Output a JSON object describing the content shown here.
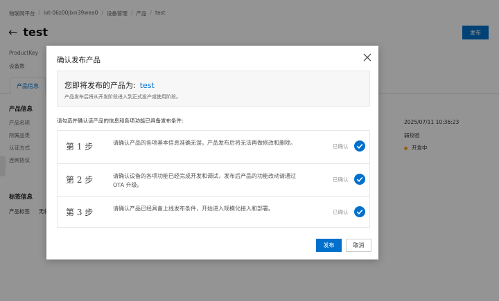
{
  "breadcrumb": [
    "物联网平台",
    "iot-06z00jlxn39wea0",
    "设备管理",
    "产品",
    "test"
  ],
  "page": {
    "title": "test",
    "publish_label": "发布",
    "meta": [
      "ProductKey",
      "设备数"
    ],
    "tab_active": "产品信息",
    "section_product_info": "产品信息",
    "fields": [
      "产品名称",
      "所属品类",
      "认证方式",
      "连网协议"
    ],
    "right_values": {
      "created_time": "2025/07/11 10:36:23",
      "validation": "弱校验",
      "status": "开发中"
    },
    "section_tags": "标签信息",
    "tag_label": "产品标签",
    "tag_value": "无标"
  },
  "modal": {
    "title": "确认发布产品",
    "summary_prefix": "您即将发布的产品为:",
    "product_name": "test",
    "summary_note": "产品发布后将从开发阶段进入到正式投产或使用阶段。",
    "instruction": "请勾选并确认该产品的信息和各项功能已具备发布条件:",
    "steps": [
      {
        "label": "第 1 步",
        "desc": "请确认产品的各项基本信息准确无误，产品发布后将无法再做修改和删除。",
        "status": "已确认"
      },
      {
        "label": "第 2 步",
        "desc": "请确认设备的各项功能已经完成开发和调试，发布后产品的功能改动请通过 OTA 升级。",
        "status": "已确认"
      },
      {
        "label": "第 3 步",
        "desc": "请确认产品已经具备上线发布条件，开始进入规模化接入和部署。",
        "status": "已确认"
      }
    ],
    "publish_label": "发布",
    "cancel_label": "取消"
  },
  "colors": {
    "accent": "#0070cc",
    "status_dot": "#f5a623"
  }
}
